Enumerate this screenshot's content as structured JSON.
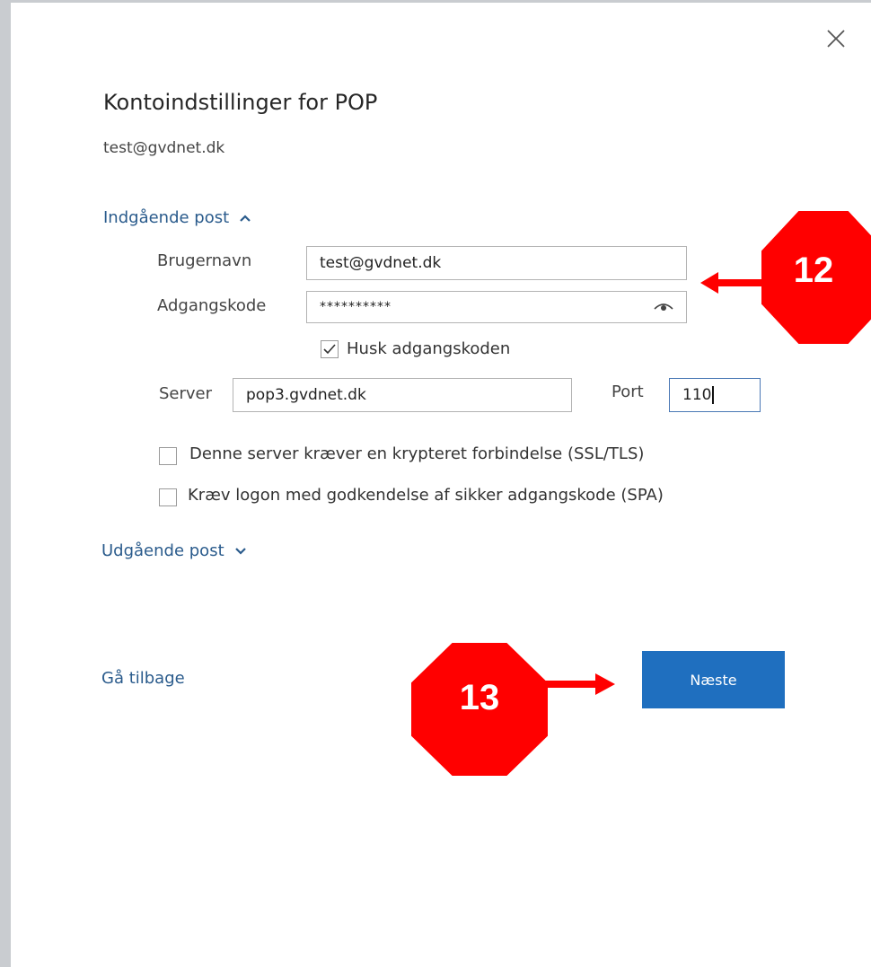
{
  "dialog": {
    "title": "Kontoindstillinger for POP",
    "email": "test@gvdnet.dk"
  },
  "incoming": {
    "section_label": "Indgående post",
    "username_label": "Brugernavn",
    "username_value": "test@gvdnet.dk",
    "password_label": "Adgangskode",
    "password_value": "**********",
    "remember_label": "Husk adgangskoden",
    "remember_checked": true,
    "server_label": "Server",
    "server_value": "pop3.gvdnet.dk",
    "port_label": "Port",
    "port_value": "110",
    "ssl_label": "Denne server kræver en krypteret forbindelse (SSL/TLS)",
    "ssl_checked": false,
    "spa_label": "Kræv logon med godkendelse af sikker adgangskode (SPA)",
    "spa_checked": false
  },
  "outgoing": {
    "section_label": "Udgående post"
  },
  "footer": {
    "back_label": "Gå tilbage",
    "next_label": "Næste"
  },
  "annotations": {
    "badge_12": "12",
    "badge_13": "13"
  },
  "colors": {
    "link": "#2a5b8c",
    "primary": "#1f6fbf",
    "annotation": "#ff0000"
  },
  "icons": [
    "close-icon",
    "chevron-up-icon",
    "chevron-down-icon",
    "eye-icon",
    "checkmark-icon",
    "arrow-left-icon",
    "arrow-right-icon"
  ]
}
